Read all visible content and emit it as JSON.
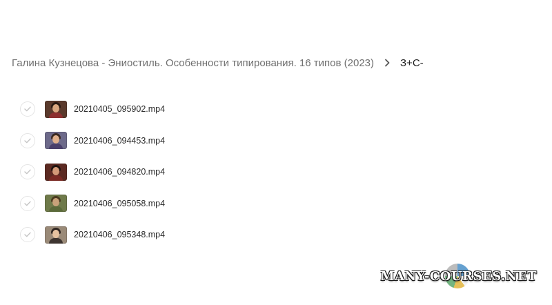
{
  "breadcrumb": {
    "parent": "Галина Кузнецова - Эниостиль. Особенности типирования. 16 типов (2023)",
    "separator_icon": "chevron-right-icon",
    "current": "З+С-"
  },
  "files": [
    {
      "name": "20210405_095902.mp4",
      "thumb": {
        "bg": "#5a3a2c",
        "hair": "#2a1a12",
        "face": "#d9a77f",
        "body": "#8c2f2f"
      }
    },
    {
      "name": "20210406_094453.mp4",
      "thumb": {
        "bg": "#6d6a8a",
        "hair": "#3a2a22",
        "face": "#e0b08c",
        "body": "#4a3f6b"
      }
    },
    {
      "name": "20210406_094820.mp4",
      "thumb": {
        "bg": "#5c2a22",
        "hair": "#1e120e",
        "face": "#d49a78",
        "body": "#7a2a24"
      }
    },
    {
      "name": "20210406_095058.mp4",
      "thumb": {
        "bg": "#6f7a4a",
        "hair": "#4a3a20",
        "face": "#c9a27a",
        "body": "#5b6a3a"
      }
    },
    {
      "name": "20210406_095348.mp4",
      "thumb": {
        "bg": "#9a8a78",
        "hair": "#2f2520",
        "face": "#e6c2a0",
        "body": "#3e3530"
      }
    }
  ],
  "check_icon": "check-circle-icon",
  "watermark": {
    "text": "MANY-COURSES.NET"
  }
}
